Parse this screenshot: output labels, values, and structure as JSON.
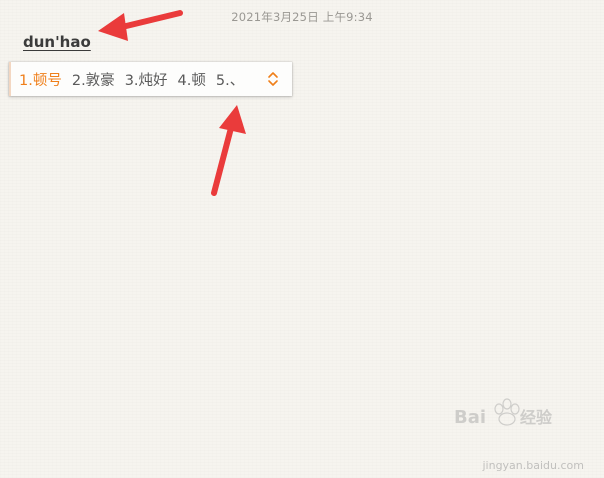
{
  "header": {
    "date": "2021年3月25日 上午9:34"
  },
  "ime": {
    "composition": "dun'hao",
    "candidates": [
      "1.顿号",
      "2.敦豪",
      "3.炖好",
      "4.顿",
      "5.、"
    ],
    "toggle_icon": "chevron-up-down-icon"
  },
  "colors": {
    "accent": "#ef7f1a",
    "annotation_arrow": "#ea3b3b"
  },
  "watermark": {
    "logo": "Bai度经验",
    "url": "jingyan.baidu.com"
  }
}
